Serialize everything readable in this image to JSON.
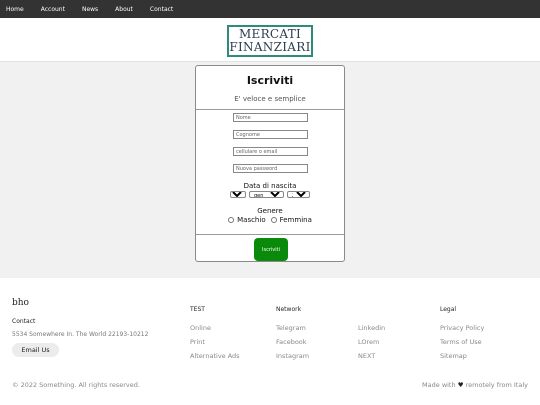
{
  "nav": {
    "items": [
      "Home",
      "Account",
      "News",
      "About",
      "Contact"
    ]
  },
  "header": {
    "logo_line1": "MERCATI",
    "logo_line2": "FINANZIARI"
  },
  "signup": {
    "title": "Iscriviti",
    "subtitle": "E' veloce e semplice",
    "fields": {
      "nome": "Nome",
      "cognome": "Cognome",
      "contatto": "cellulare o email",
      "password": "Nuova password"
    },
    "dob_label": "Data di nascita",
    "day": "1",
    "month": "gen",
    "year": "2022",
    "gender_label": "Genere",
    "gender_options": [
      "Maschio",
      "Femmina"
    ],
    "submit_label": "Iscriviti"
  },
  "footer": {
    "brand": "bho",
    "contact_heading": "Contact",
    "address": "5534 Somewhere In. The World 22193-10212",
    "email_button": "Email Us",
    "col1": {
      "heading": "TEST",
      "links": [
        "Online",
        "Print",
        "Alternative Ads"
      ]
    },
    "col2": {
      "heading": "Network",
      "links": [
        "Telegram",
        "Facebook",
        "Instagram"
      ]
    },
    "col3": {
      "heading": "",
      "links": [
        "Linkedin",
        "LOrem",
        "NEXT"
      ]
    },
    "col4": {
      "heading": "Legal",
      "links": [
        "Privacy Policy",
        "Terms of Use",
        "Sitemap"
      ]
    },
    "copyright": "© 2022 Something. All rights reserved.",
    "made_prefix": "Made with",
    "made_suffix": "remotely from Italy"
  },
  "colors": {
    "nav_bg": "#333333",
    "logo_border": "#2f8a7e",
    "submit_bg": "#0a8a0a",
    "page_bg": "#f1f1f1"
  }
}
